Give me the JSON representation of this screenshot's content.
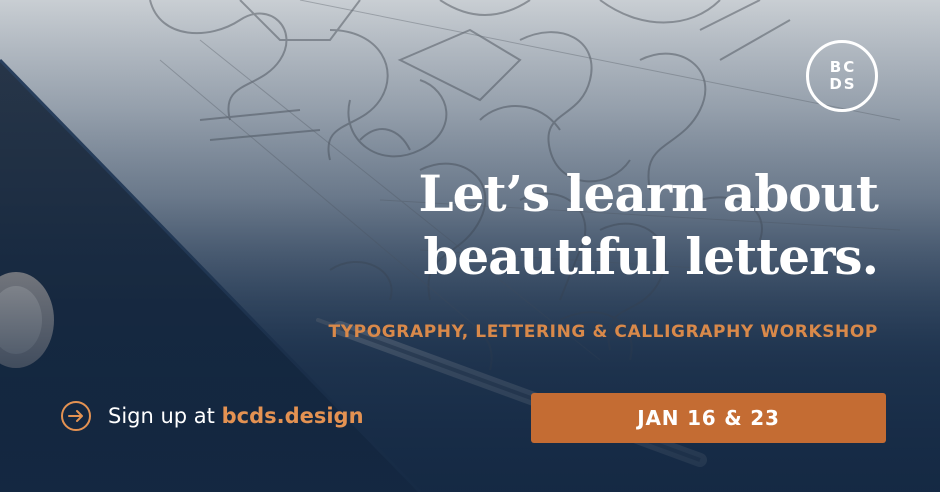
{
  "logo": {
    "line1": "BC",
    "line2": "DS"
  },
  "headline": {
    "line1": "Let’s learn about",
    "line2": "beautiful letters."
  },
  "subtitle": "TYPOGRAPHY, LETTERING & CALLIGRAPHY WORKSHOP",
  "signup": {
    "prefix": "Sign up at",
    "site": "bcds.design",
    "icon": "arrow-right-circle-icon"
  },
  "date_button": {
    "label": "JAN 16 & 23"
  },
  "colors": {
    "accent": "#c46c33",
    "navy": "#1b3453",
    "white": "#ffffff"
  }
}
